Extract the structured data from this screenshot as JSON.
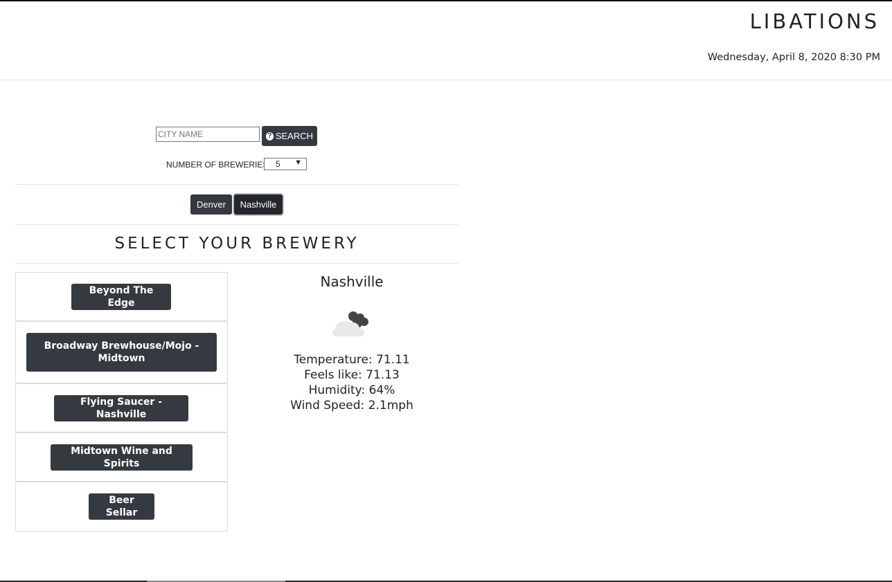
{
  "header": {
    "title": "LIBATIONS",
    "datetime": "Wednesday, April 8, 2020 8:30 PM"
  },
  "search": {
    "placeholder": "CITY NAME",
    "value": "",
    "button_label": "SEARCH",
    "button_icon": "question-circle-icon"
  },
  "count": {
    "label": "NUMBER OF BREWERIES:",
    "selected": "5"
  },
  "cities": [
    {
      "label": "Denver"
    },
    {
      "label": "Nashville"
    }
  ],
  "section_title": "SELECT YOUR BREWERY",
  "breweries": [
    {
      "label": "Beyond The Edge"
    },
    {
      "label": "Broadway Brewhouse/Mojo - Midtown"
    },
    {
      "label": "Flying Saucer - Nashville"
    },
    {
      "label": "Midtown Wine and Spirits"
    },
    {
      "label": "Beer Sellar"
    }
  ],
  "weather": {
    "city": "Nashville",
    "icon": "cloudy-icon",
    "temperature": "Temperature: 71.11",
    "feels_like": "Feels like: 71.13",
    "humidity": "Humidity: 64%",
    "wind": "Wind Speed: 2.1mph"
  },
  "colors": {
    "button": "#343a40",
    "button_active": "#23272b",
    "text": "#212529"
  }
}
